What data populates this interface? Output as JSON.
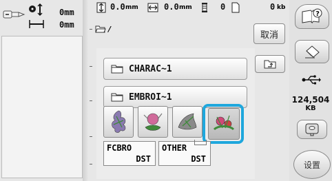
{
  "left_panel": {
    "width_value": "0mm",
    "height_value": "0mm"
  },
  "top_status": {
    "height_value": "0.0",
    "height_unit": "mm",
    "width_value": "0.0",
    "width_unit": "mm",
    "stitch_count": "0",
    "color_count": "0",
    "memory_value": "0",
    "memory_unit": "kb"
  },
  "path": {
    "current": "/"
  },
  "buttons": {
    "cancel": "取消",
    "settings": "设置"
  },
  "folders": [
    {
      "name": "CHARAC~1"
    },
    {
      "name": "EMBROI~1"
    }
  ],
  "files": [
    {
      "name": "FCBRO",
      "ext": "DST"
    },
    {
      "name": "OTHER",
      "ext": "DST"
    }
  ],
  "usb": {
    "capacity": "124,504",
    "unit": "KB"
  },
  "colors": {
    "selection_border": "#1ea7dd",
    "panel_bg": "#e7e7e7",
    "embroidery_pink": "#d04a78",
    "embroidery_green": "#3f8a3a"
  },
  "icons": [
    "machine-presser-icon",
    "width-height-size-icon",
    "height-arrow-icon",
    "width-arrow-icon",
    "thread-spool-icon",
    "color-document-icon",
    "folder-open-icon",
    "folder-up-icon",
    "help-book-icon",
    "eraser-icon",
    "usb-icon",
    "usb-media-icon",
    "folder-icon"
  ]
}
